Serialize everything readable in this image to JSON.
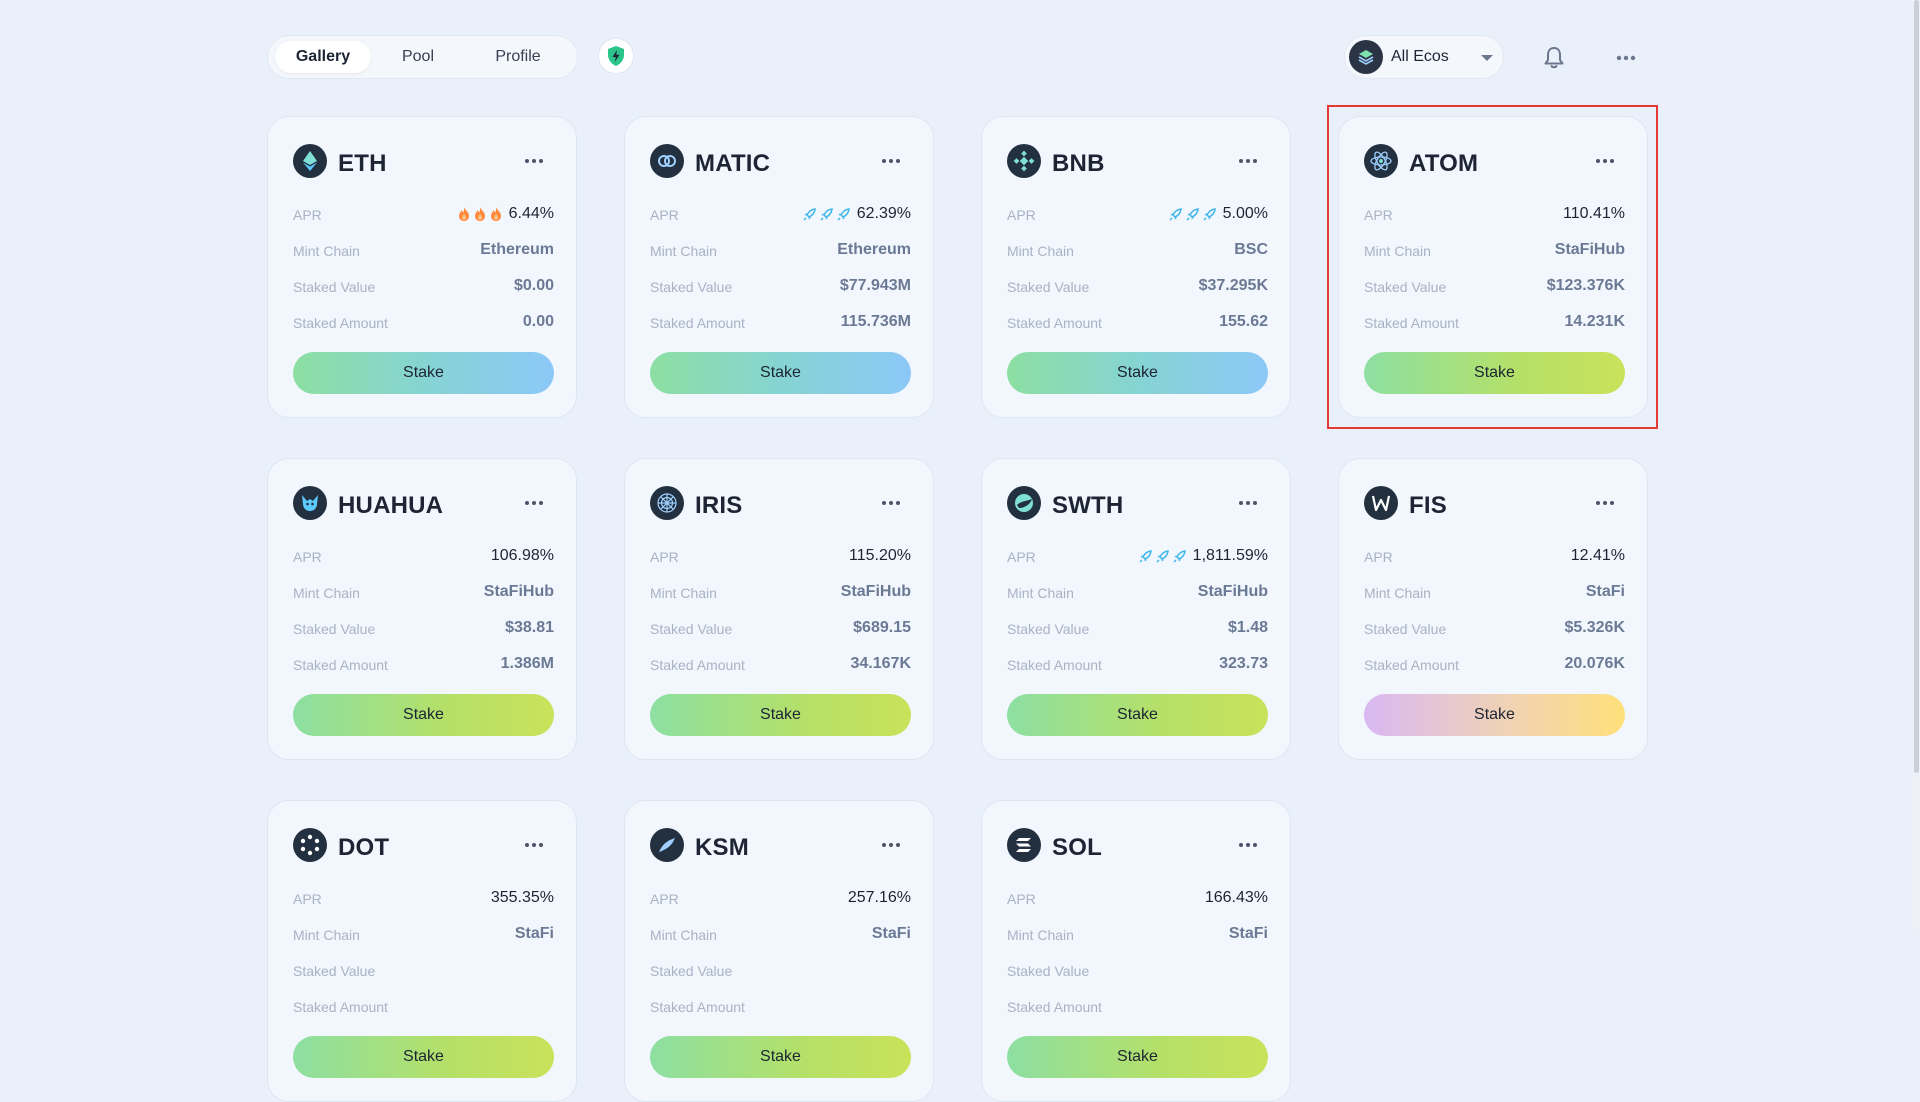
{
  "nav": {
    "tabs": [
      {
        "label": "Gallery",
        "active": true
      },
      {
        "label": "Pool",
        "active": false
      },
      {
        "label": "Profile",
        "active": false
      }
    ],
    "shield_icon": "shield-bolt-icon",
    "eco_select": {
      "label": "All Ecos",
      "icon": "layers-icon"
    },
    "bell_icon": "bell-icon",
    "more_icon": "more-horizontal-icon"
  },
  "labels": {
    "apr": "APR",
    "mint_chain": "Mint Chain",
    "staked_value": "Staked Value",
    "staked_amount": "Staked Amount",
    "stake": "Stake"
  },
  "cards": [
    {
      "symbol": "ETH",
      "icon": "eth-icon",
      "apr": "6.44%",
      "apr_badge": "fire",
      "mint_chain": "Ethereum",
      "staked_value": "$0.00",
      "staked_amount": "0.00",
      "button_style": "blue"
    },
    {
      "symbol": "MATIC",
      "icon": "matic-icon",
      "apr": "62.39%",
      "apr_badge": "rocket",
      "mint_chain": "Ethereum",
      "staked_value": "$77.943M",
      "staked_amount": "115.736M",
      "button_style": "blue"
    },
    {
      "symbol": "BNB",
      "icon": "bnb-icon",
      "apr": "5.00%",
      "apr_badge": "rocket",
      "mint_chain": "BSC",
      "staked_value": "$37.295K",
      "staked_amount": "155.62",
      "button_style": "blue"
    },
    {
      "symbol": "ATOM",
      "icon": "atom-icon",
      "apr": "110.41%",
      "apr_badge": "",
      "mint_chain": "StaFiHub",
      "staked_value": "$123.376K",
      "staked_amount": "14.231K",
      "button_style": "lime"
    },
    {
      "symbol": "HUAHUA",
      "icon": "huahua-icon",
      "apr": "106.98%",
      "apr_badge": "",
      "mint_chain": "StaFiHub",
      "staked_value": "$38.81",
      "staked_amount": "1.386M",
      "button_style": "lime"
    },
    {
      "symbol": "IRIS",
      "icon": "iris-icon",
      "apr": "115.20%",
      "apr_badge": "",
      "mint_chain": "StaFiHub",
      "staked_value": "$689.15",
      "staked_amount": "34.167K",
      "button_style": "lime"
    },
    {
      "symbol": "SWTH",
      "icon": "swth-icon",
      "apr": "1,811.59%",
      "apr_badge": "rocket",
      "mint_chain": "StaFiHub",
      "staked_value": "$1.48",
      "staked_amount": "323.73",
      "button_style": "lime"
    },
    {
      "symbol": "FIS",
      "icon": "fis-icon",
      "apr": "12.41%",
      "apr_badge": "",
      "mint_chain": "StaFi",
      "staked_value": "$5.326K",
      "staked_amount": "20.076K",
      "button_style": "sunset"
    },
    {
      "symbol": "DOT",
      "icon": "dot-icon",
      "apr": "355.35%",
      "apr_badge": "",
      "mint_chain": "StaFi",
      "staked_value": "",
      "staked_amount": "",
      "button_style": "lime"
    },
    {
      "symbol": "KSM",
      "icon": "ksm-icon",
      "apr": "257.16%",
      "apr_badge": "",
      "mint_chain": "StaFi",
      "staked_value": "",
      "staked_amount": "",
      "button_style": "lime"
    },
    {
      "symbol": "SOL",
      "icon": "sol-icon",
      "apr": "166.43%",
      "apr_badge": "",
      "mint_chain": "StaFi",
      "staked_value": "",
      "staked_amount": "",
      "button_style": "lime"
    }
  ],
  "colors": {
    "background": "#e9f0fa",
    "card": "#f2f6fd",
    "highlight": "#e53935",
    "fire": "#ff7a3d",
    "rocket": "#3fb6e8"
  }
}
